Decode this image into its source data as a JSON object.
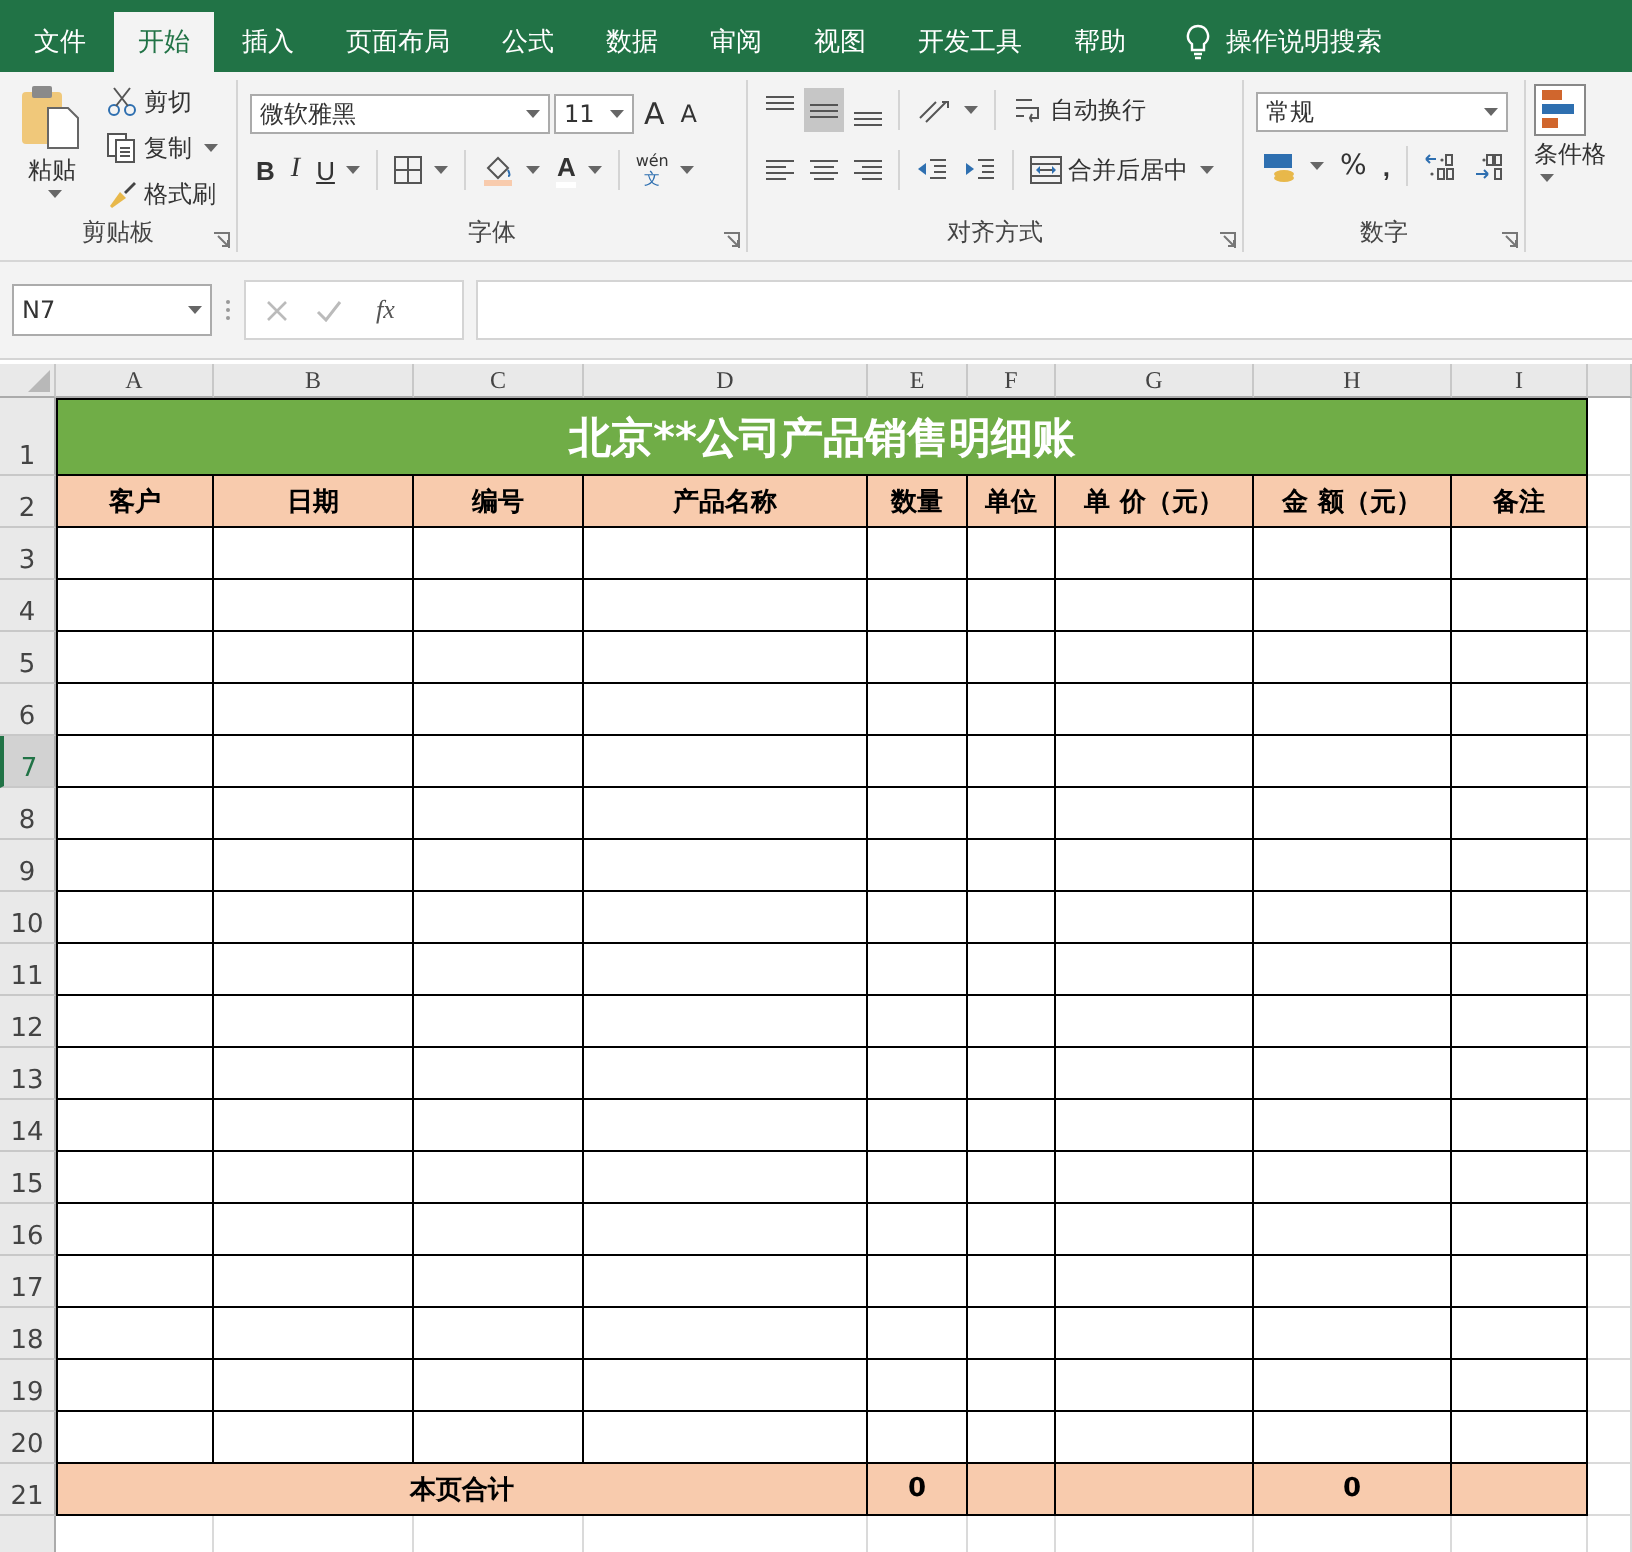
{
  "tabs": [
    {
      "label": "文件",
      "selected": false
    },
    {
      "label": "开始",
      "selected": true
    },
    {
      "label": "插入",
      "selected": false
    },
    {
      "label": "页面布局",
      "selected": false
    },
    {
      "label": "公式",
      "selected": false
    },
    {
      "label": "数据",
      "selected": false
    },
    {
      "label": "审阅",
      "selected": false
    },
    {
      "label": "视图",
      "selected": false
    },
    {
      "label": "开发工具",
      "selected": false
    },
    {
      "label": "帮助",
      "selected": false
    }
  ],
  "tell_me": {
    "label": "操作说明搜索"
  },
  "ribbon": {
    "clipboard": {
      "label": "剪贴板",
      "paste": "粘贴",
      "cut": "剪切",
      "copy": "复制",
      "format_painter": "格式刷"
    },
    "font": {
      "label": "字体",
      "font_name": "微软雅黑",
      "font_size": "11",
      "grow": "A",
      "shrink": "A",
      "bold": "B",
      "italic": "I",
      "underline": "U",
      "font_color": "A",
      "phonetic_top": "wén",
      "phonetic_bottom": "文"
    },
    "alignment": {
      "label": "对齐方式",
      "vertical": [
        {
          "kind": "top",
          "selected": false
        },
        {
          "kind": "middle",
          "selected": true
        },
        {
          "kind": "bottom",
          "selected": false
        }
      ],
      "horizontal": [
        {
          "kind": "left",
          "selected": false
        },
        {
          "kind": "center",
          "selected": false
        },
        {
          "kind": "right",
          "selected": false
        }
      ],
      "wrap_text": "自动换行",
      "merge_center": "合并后居中"
    },
    "number": {
      "label": "数字",
      "format": "常规",
      "percent": "%",
      "comma": ","
    },
    "styles": {
      "conditional_formatting": "条件格"
    }
  },
  "formula_bar": {
    "name_box": "N7",
    "fx": "fx"
  },
  "sheet": {
    "columns": [
      "A",
      "B",
      "C",
      "D",
      "E",
      "F",
      "G",
      "H",
      "I"
    ],
    "title": {
      "row": "1",
      "text": "北京**公司产品销售明细账"
    },
    "header": {
      "row": "2",
      "cells": [
        "客户",
        "日期",
        "编号",
        "产品名称",
        "数量",
        "单位",
        "单 价（元）",
        "金 额（元）",
        "备注"
      ]
    },
    "rows": [
      {
        "header": "3",
        "selected": false
      },
      {
        "header": "4",
        "selected": false
      },
      {
        "header": "5",
        "selected": false
      },
      {
        "header": "6",
        "selected": false
      },
      {
        "header": "7",
        "selected": true
      },
      {
        "header": "8",
        "selected": false
      },
      {
        "header": "9",
        "selected": false
      },
      {
        "header": "10",
        "selected": false
      },
      {
        "header": "11",
        "selected": false
      },
      {
        "header": "12",
        "selected": false
      },
      {
        "header": "13",
        "selected": false
      },
      {
        "header": "14",
        "selected": false
      },
      {
        "header": "15",
        "selected": false
      },
      {
        "header": "16",
        "selected": false
      },
      {
        "header": "17",
        "selected": false
      },
      {
        "header": "18",
        "selected": false
      },
      {
        "header": "19",
        "selected": false
      },
      {
        "header": "20",
        "selected": false
      }
    ],
    "total": {
      "row": "21",
      "label": "本页合计",
      "quantity": "0",
      "amount": "0"
    }
  }
}
